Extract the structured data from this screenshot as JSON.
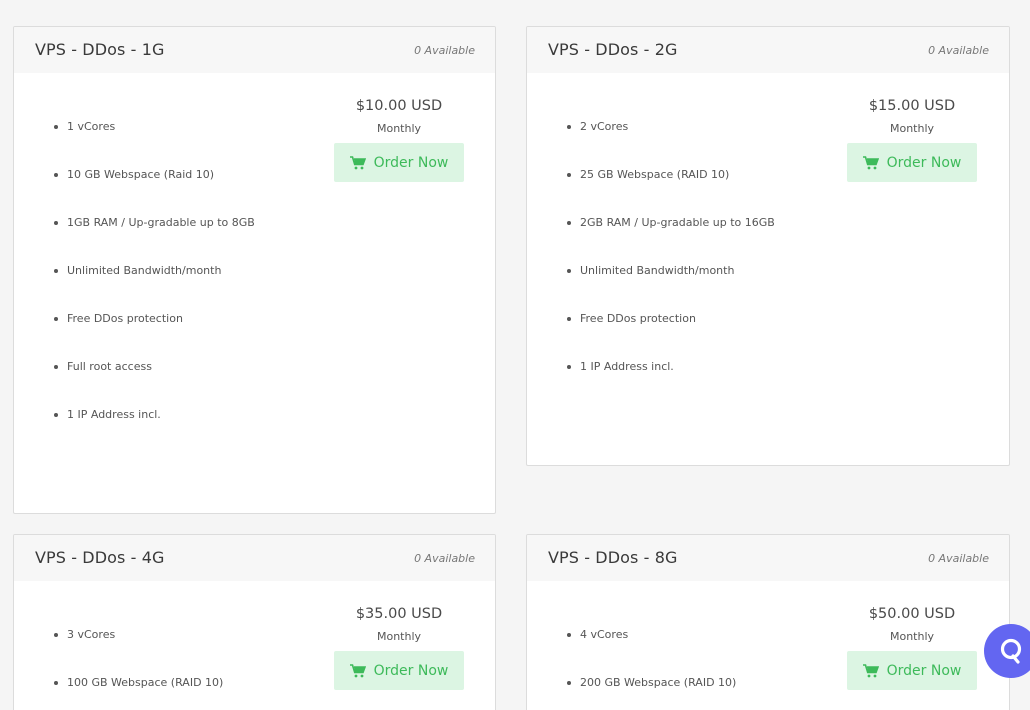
{
  "order_label": "Order Now",
  "colors": {
    "accent": "#3dba5a",
    "button_bg": "#dcf5e3",
    "chat": "#6366f1"
  },
  "plans": [
    {
      "title": "VPS - DDos - 1G",
      "availability": "0 Available",
      "price": "$10.00 USD",
      "cycle": "Monthly",
      "features": [
        "1 vCores",
        "10 GB Webspace (Raid 10)",
        "1GB RAM / Up-gradable up to 8GB",
        "Unlimited Bandwidth/month",
        "Free DDos protection",
        "Full root access",
        "1 IP Address incl."
      ]
    },
    {
      "title": "VPS - DDos - 2G",
      "availability": "0 Available",
      "price": "$15.00 USD",
      "cycle": "Monthly",
      "features": [
        "2 vCores",
        "25 GB Webspace (RAID 10)",
        "2GB RAM / Up-gradable up to 16GB",
        "Unlimited Bandwidth/month",
        "Free DDos protection",
        "1 IP Address incl."
      ]
    },
    {
      "title": "VPS - DDos - 4G",
      "availability": "0 Available",
      "price": "$35.00 USD",
      "cycle": "Monthly",
      "features": [
        "3 vCores",
        "100 GB Webspace (RAID 10)"
      ]
    },
    {
      "title": "VPS - DDos - 8G",
      "availability": "0 Available",
      "price": "$50.00 USD",
      "cycle": "Monthly",
      "features": [
        "4 vCores",
        "200 GB Webspace (RAID 10)"
      ]
    }
  ],
  "chat_icon": "chat-bubble-icon"
}
